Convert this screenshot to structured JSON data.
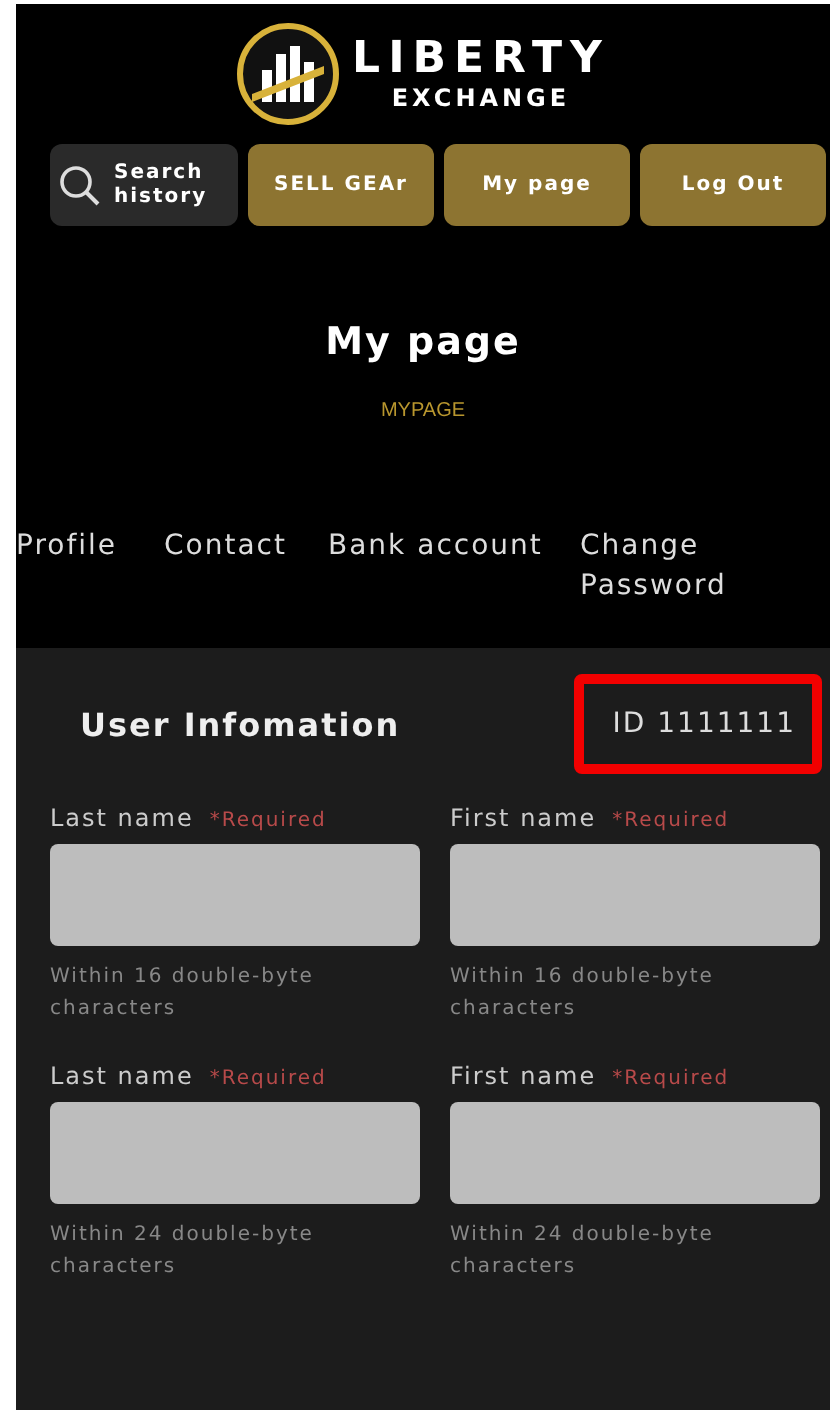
{
  "header": {
    "logo": {
      "title": "LIBERTY",
      "subtitle": "EXCHANGE"
    },
    "buttons": [
      {
        "kind": "search",
        "label": "Search history"
      },
      {
        "kind": "gold",
        "label": "SELL GEAr"
      },
      {
        "kind": "gold",
        "label": "My page"
      },
      {
        "kind": "gold",
        "label": "Log Out"
      }
    ]
  },
  "page": {
    "title": "My page",
    "subtitle": "MYPAGE"
  },
  "tabs": [
    {
      "label": "Profile"
    },
    {
      "label": "Contact"
    },
    {
      "label": "Bank account"
    },
    {
      "label": "Change Password"
    }
  ],
  "user_info": {
    "title": "User Infomation",
    "id": "ID 1111111",
    "id_highlighted": true,
    "fields": [
      {
        "label": "Last name",
        "required": "*Required",
        "hint": "Within 16 double-byte characters"
      },
      {
        "label": "First name",
        "required": "*Required",
        "hint": "Within 16 double-byte characters"
      },
      {
        "label": "Last name",
        "required": "*Required",
        "hint": "Within 24 double-byte characters"
      },
      {
        "label": "First name",
        "required": "*Required",
        "hint": "Within 24 double-byte characters"
      }
    ]
  }
}
